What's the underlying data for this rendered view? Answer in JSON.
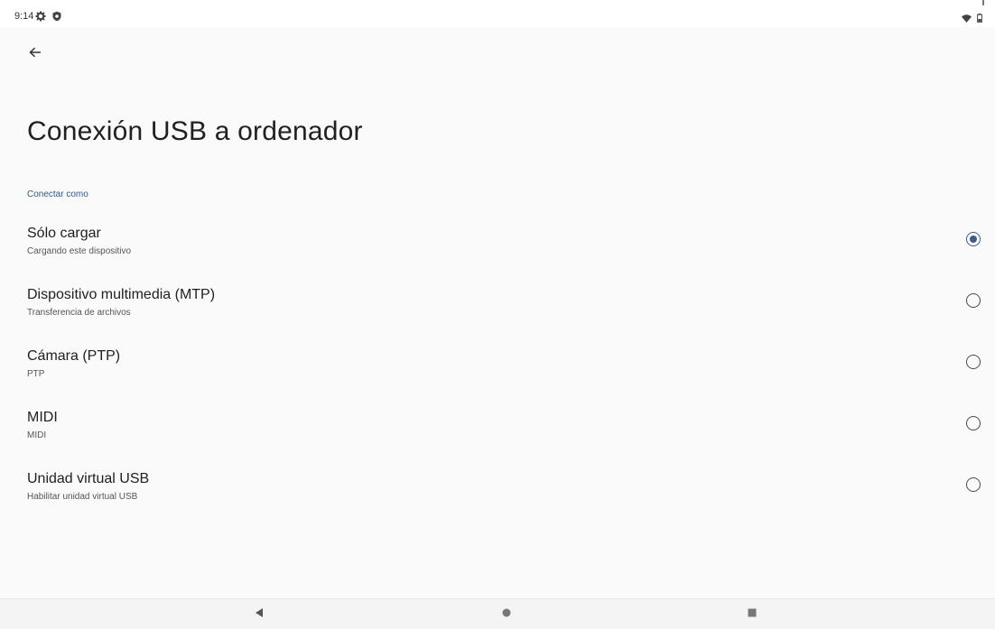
{
  "status_bar": {
    "time": "9:14",
    "left_icons": [
      "gear-icon",
      "shield-icon"
    ],
    "right_icons": [
      "wifi-icon",
      "battery-icon"
    ]
  },
  "header": {
    "back_icon": "arrow-left-icon",
    "title": "Conexión USB a ordenador"
  },
  "section": {
    "header": "Conectar como"
  },
  "options": [
    {
      "title": "Sólo cargar",
      "subtitle": "Cargando este dispositivo",
      "selected": true
    },
    {
      "title": "Dispositivo multimedia (MTP)",
      "subtitle": "Transferencia de archivos",
      "selected": false
    },
    {
      "title": "Cámara (PTP)",
      "subtitle": "PTP",
      "selected": false
    },
    {
      "title": "MIDI",
      "subtitle": "MIDI",
      "selected": false
    },
    {
      "title": "Unidad virtual USB",
      "subtitle": "Habilitar unidad virtual USB",
      "selected": false
    }
  ],
  "nav_bar": {
    "buttons": [
      "back-triangle-icon",
      "home-circle-icon",
      "recents-square-icon"
    ]
  },
  "colors": {
    "accent": "#3f5a86",
    "section_header": "#2e5a8a",
    "background": "#fafafa"
  }
}
